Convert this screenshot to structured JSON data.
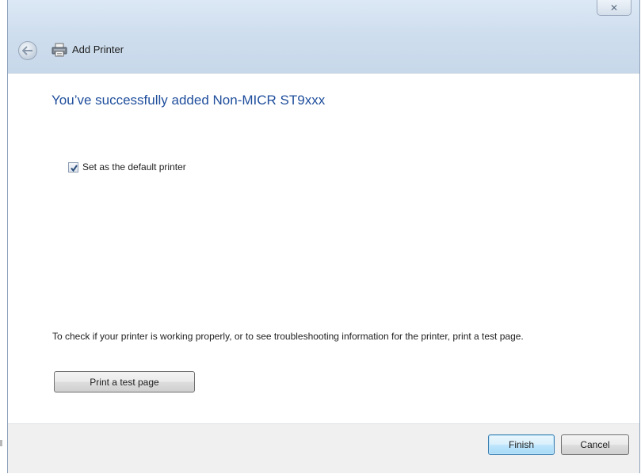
{
  "window": {
    "title": "Add Printer",
    "close_symbol": "✕"
  },
  "content": {
    "heading": "You’ve successfully added Non-MICR ST9xxx",
    "default_printer_checkbox": {
      "label": "Set as the default printer",
      "checked": true
    },
    "info_text": "To check if your printer is working properly, or to see troubleshooting information for the printer, print a test page.",
    "test_page_button": "Print a test page"
  },
  "footer": {
    "finish_label": "Finish",
    "cancel_label": "Cancel"
  },
  "icons": {
    "back": "back-arrow-icon",
    "printer": "printer-icon",
    "close": "close-icon",
    "checkmark": "checkmark-icon"
  },
  "colors": {
    "heading": "#1f4e9c",
    "titlebar": "#cfdeee",
    "footer": "#f0f0f0"
  }
}
